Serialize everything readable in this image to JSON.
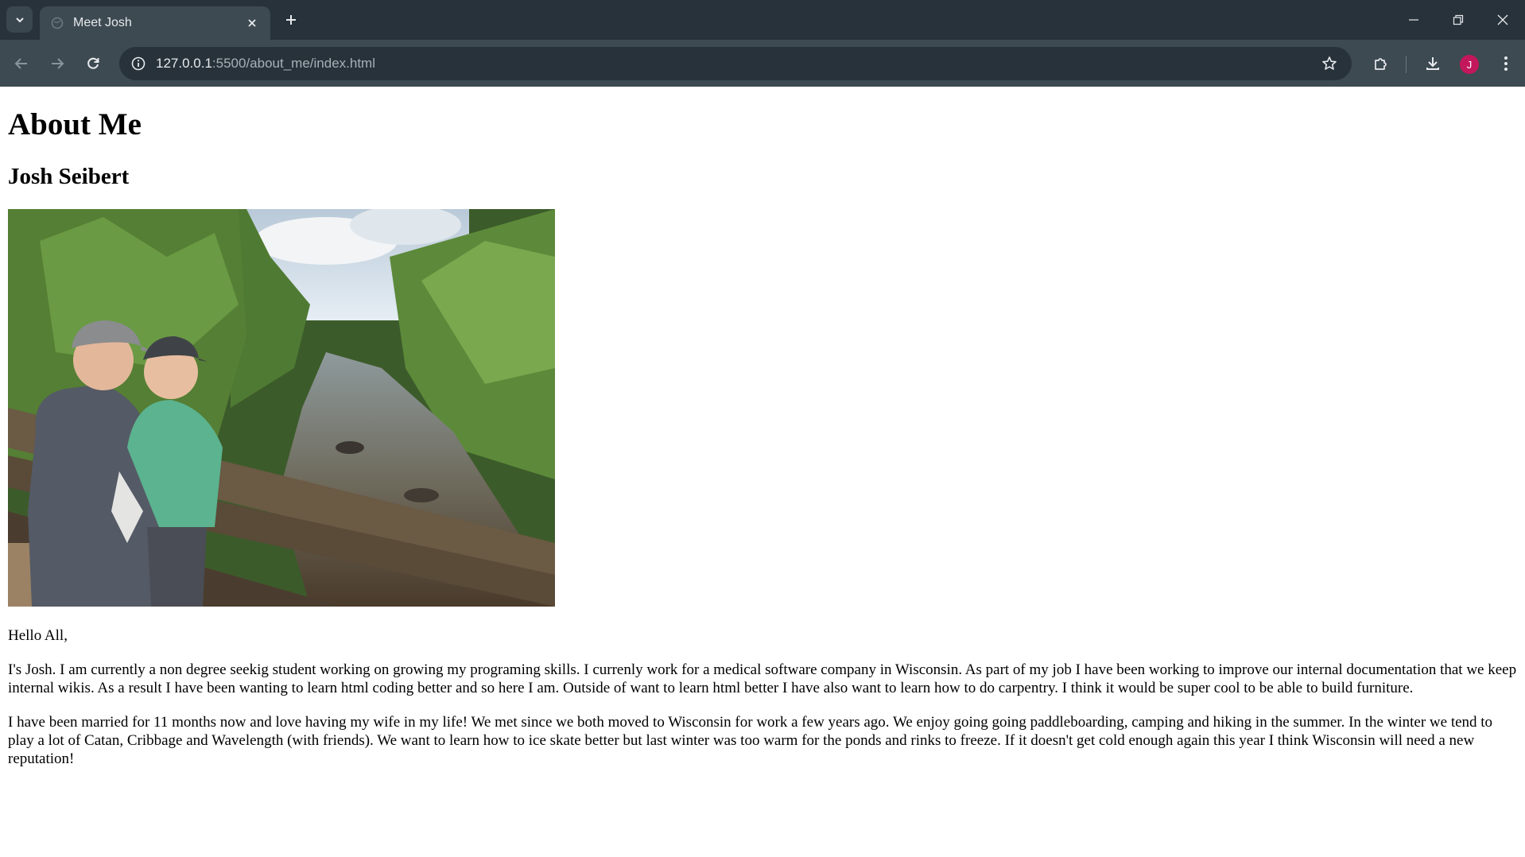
{
  "browser": {
    "tab": {
      "title": "Meet Josh"
    },
    "address": {
      "host": "127.0.0.1",
      "path": ":5500/about_me/index.html"
    },
    "profile": {
      "initial": "J"
    },
    "icons": [
      "tab-search-icon",
      "globe-icon",
      "close-icon",
      "plus-icon",
      "minimize-icon",
      "restore-icon",
      "back-icon",
      "forward-icon",
      "reload-icon",
      "info-icon",
      "star-icon",
      "extensions-icon",
      "download-icon",
      "more-vert-icon"
    ]
  },
  "page": {
    "heading": "About Me",
    "subheading": "Josh Seibert",
    "greeting": "Hello All,",
    "paragraph1": "I's Josh. I am currently a non degree seekig student working on growing my programing skills. I currenly work for a medical software company in Wisconsin. As part of my job I have been working to improve our internal documentation that we keep internal wikis. As a result I have been wanting to learn html coding better and so here I am. Outside of want to learn html better I have also want to learn how to do carpentry. I think it would be super cool to be able to build furniture.",
    "paragraph2": "I have been married for 11 months now and love having my wife in my life! We met since we both moved to Wisconsin for work a few years ago. We enjoy going going paddleboarding, camping and hiking in the summer. In the winter we tend to play a lot of Catan, Cribbage and Wavelength (with friends). We want to learn how to ice skate better but last winter was too warm for the ponds and rinks to freeze. If it doesn't get cold enough again this year I think Wisconsin will need a new reputation!"
  },
  "colors": {
    "chrome_dark": "#27323a",
    "chrome_light": "#3d4a52",
    "avatar": "#c2185b"
  }
}
